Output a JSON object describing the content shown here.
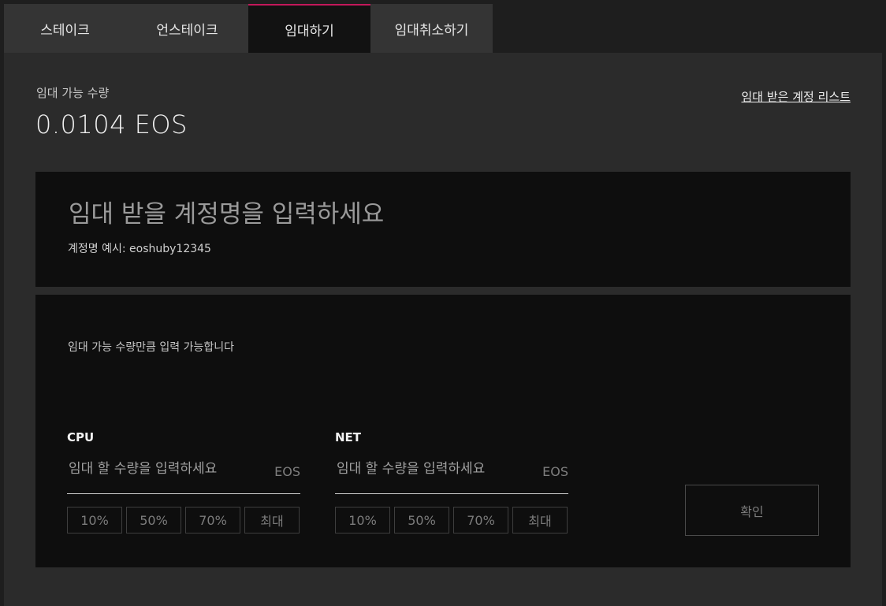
{
  "tabs": [
    {
      "label": "스테이크",
      "active": false
    },
    {
      "label": "언스테이크",
      "active": false
    },
    {
      "label": "임대하기",
      "active": true
    },
    {
      "label": "임대취소하기",
      "active": false
    }
  ],
  "colors": {
    "accent": "#c2185b",
    "background": "#1e1e1e",
    "panel": "#2b2b2b",
    "box": "#0e0e0e"
  },
  "summary": {
    "available_label": "임대 가능 수량",
    "available_value": "0.0104 EOS",
    "list_link": "임대 받은 계정 리스트"
  },
  "account": {
    "placeholder": "임대 받을 계정명을 입력하세요",
    "hint": "계정명 예시: eoshuby12345"
  },
  "amount": {
    "note": "임대 가능 수량만큼 입력 가능합니다",
    "cpu": {
      "title": "CPU",
      "placeholder": "임대 할 수량을 입력하세요",
      "unit": "EOS",
      "buttons": [
        "10%",
        "50%",
        "70%",
        "최대"
      ]
    },
    "net": {
      "title": "NET",
      "placeholder": "임대 할 수량을 입력하세요",
      "unit": "EOS",
      "buttons": [
        "10%",
        "50%",
        "70%",
        "최대"
      ]
    },
    "confirm_label": "확인"
  }
}
